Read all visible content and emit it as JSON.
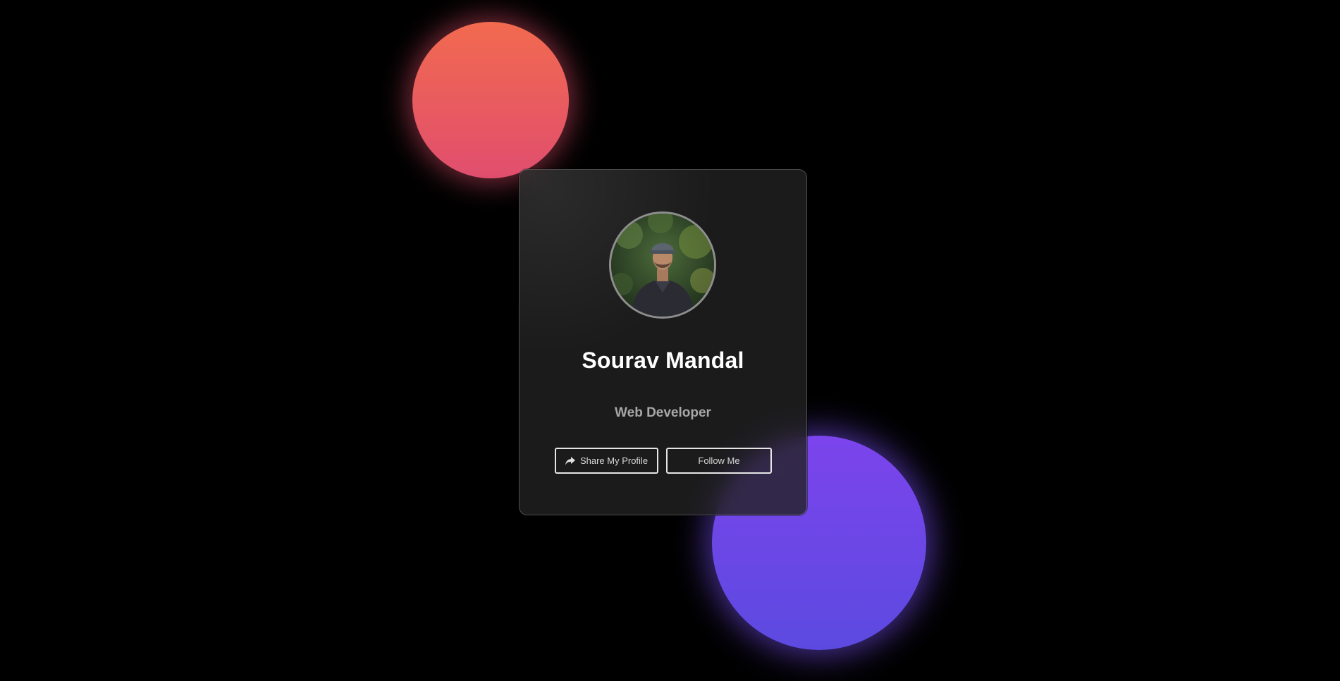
{
  "profile": {
    "name": "Sourav Mandal",
    "role": "Web Developer"
  },
  "actions": {
    "share_label": "Share My Profile",
    "share_icon": "share-arrow-icon",
    "follow_label": "Follow Me"
  },
  "colors": {
    "background": "#000000",
    "orb_top": "#f26a4f",
    "orb_bottom": "#7c44ec",
    "card": "#222222"
  }
}
